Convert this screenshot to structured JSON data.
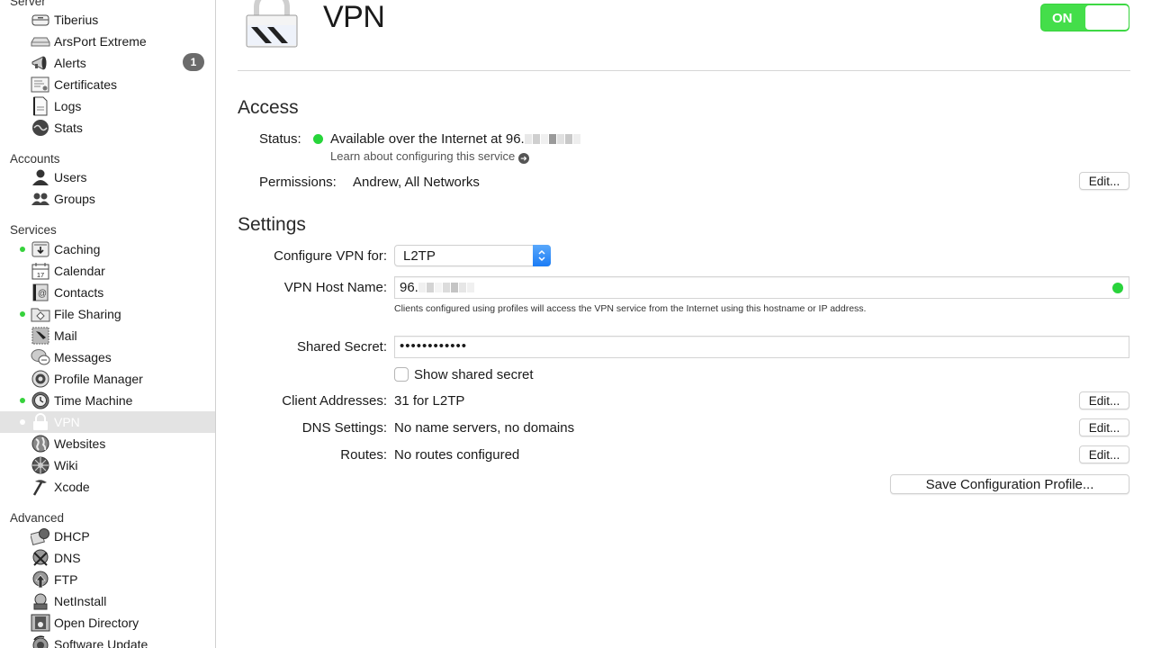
{
  "sidebar": {
    "groups": [
      {
        "title": "Server"
      },
      {
        "title": "Accounts"
      },
      {
        "title": "Services"
      },
      {
        "title": "Advanced"
      }
    ],
    "server_items": [
      {
        "label": "Tiberius",
        "icon": "server-icon"
      },
      {
        "label": "ArsPort Extreme",
        "icon": "airport-icon"
      },
      {
        "label": "Alerts",
        "icon": "megaphone-icon",
        "badge": "1"
      },
      {
        "label": "Certificates",
        "icon": "certificate-icon"
      },
      {
        "label": "Logs",
        "icon": "document-icon"
      },
      {
        "label": "Stats",
        "icon": "stats-icon"
      }
    ],
    "account_items": [
      {
        "label": "Users",
        "icon": "user-icon"
      },
      {
        "label": "Groups",
        "icon": "group-icon"
      }
    ],
    "service_items": [
      {
        "label": "Caching",
        "icon": "caching-icon",
        "status": "on"
      },
      {
        "label": "Calendar",
        "icon": "calendar-icon",
        "calendar_day": "17"
      },
      {
        "label": "Contacts",
        "icon": "contacts-icon"
      },
      {
        "label": "File Sharing",
        "icon": "folder-icon",
        "status": "on"
      },
      {
        "label": "Mail",
        "icon": "mail-icon"
      },
      {
        "label": "Messages",
        "icon": "messages-icon"
      },
      {
        "label": "Profile Manager",
        "icon": "gear-icon"
      },
      {
        "label": "Time Machine",
        "icon": "time-machine-icon",
        "status": "on"
      },
      {
        "label": "VPN",
        "icon": "lock-icon",
        "status": "on",
        "selected": true
      },
      {
        "label": "Websites",
        "icon": "globe-icon"
      },
      {
        "label": "Wiki",
        "icon": "wiki-icon"
      },
      {
        "label": "Xcode",
        "icon": "hammer-icon"
      }
    ],
    "advanced_items": [
      {
        "label": "DHCP",
        "icon": "dhcp-icon"
      },
      {
        "label": "DNS",
        "icon": "dns-icon"
      },
      {
        "label": "FTP",
        "icon": "ftp-icon"
      },
      {
        "label": "NetInstall",
        "icon": "netinstall-icon"
      },
      {
        "label": "Open Directory",
        "icon": "open-directory-icon"
      },
      {
        "label": "Software Update",
        "icon": "software-update-icon"
      }
    ]
  },
  "header": {
    "title": "VPN",
    "toggle_label": "ON",
    "toggle_state": "on",
    "toggle_color": "#44de4a"
  },
  "access": {
    "title": "Access",
    "status_label": "Status:",
    "status_text": "Available over the Internet at 96.",
    "status_color": "#27d53a",
    "learn_link": "Learn about configuring this service",
    "permissions_label": "Permissions:",
    "permissions_value": "Andrew, All Networks",
    "edit_label": "Edit..."
  },
  "settings": {
    "title": "Settings",
    "configure_label": "Configure VPN for:",
    "configure_value": "L2TP",
    "hostname_label": "VPN Host Name:",
    "hostname_value": "96.",
    "hostname_hint": "Clients configured using profiles will access the VPN service from the Internet using this hostname or IP address.",
    "secret_label": "Shared Secret:",
    "secret_value": "••••••••••••",
    "show_secret_label": "Show shared secret",
    "show_secret_checked": false,
    "client_label": "Client Addresses:",
    "client_value": "31 for L2TP",
    "dns_label": "DNS Settings:",
    "dns_value": "No name servers, no domains",
    "routes_label": "Routes:",
    "routes_value": "No routes configured",
    "edit_label": "Edit...",
    "save_profile_label": "Save Configuration Profile..."
  }
}
